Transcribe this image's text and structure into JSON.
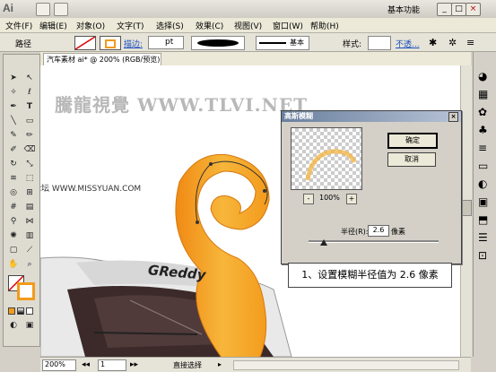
{
  "app": {
    "logo": "Ai",
    "workspace": "基本功能",
    "minimize": "_",
    "maximize": "□",
    "close": "×"
  },
  "menu": [
    "文件(F)",
    "编辑(E)",
    "对象(O)",
    "文字(T)",
    "选择(S)",
    "效果(C)",
    "视图(V)",
    "窗口(W)",
    "帮助(H)"
  ],
  "control": {
    "selection_label": "路径",
    "stroke_label": "描边:",
    "stroke_unit": "pt",
    "style_label": "基本",
    "style2_label": "样式:",
    "opacity_label": "不透..."
  },
  "document": {
    "tab_title": "汽车素材 ai* @ 200% (RGB/预览)",
    "zoom": "200%",
    "page": "1",
    "status": "直接选择"
  },
  "watermark": {
    "main": "騰龍視覺 WWW.TLVI.NET",
    "sub": "思缘设计论坛 WWW.MISSYUAN.COM"
  },
  "car_text": "GReddy",
  "dialog": {
    "title": "高斯模糊",
    "ok": "确定",
    "cancel": "取消",
    "preview_zoom": "100%",
    "minus": "-",
    "plus": "+",
    "radius_label": "半径(R):",
    "radius_value": "2.6",
    "radius_unit": "像素"
  },
  "callout": "1、设置模糊半径值为 2.6 像素",
  "colors": {
    "orange": "#f39a1c",
    "orange_light": "#f7c14a",
    "dialog_title": "#6a7f9e"
  }
}
